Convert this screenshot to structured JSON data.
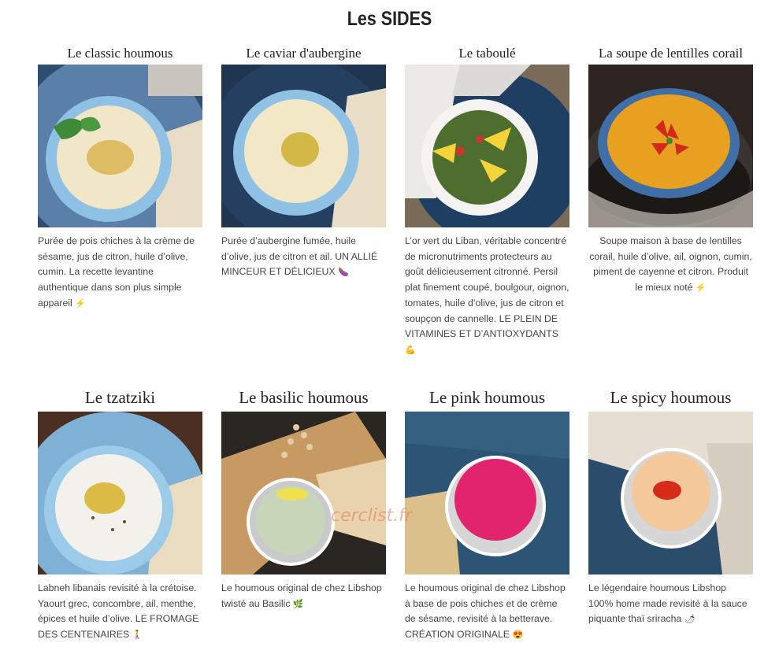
{
  "page": {
    "title": "Les SIDES"
  },
  "cards": [
    {
      "title": "Le classic houmous",
      "image": "classic-houmous-photo",
      "description": "Purée de pois chiches à la crème de sésame, jus de citron, huile d’olive, cumin. La recette levantine authentique dans son plus simple appareil",
      "emoji": "⚡"
    },
    {
      "title": "Le caviar d'aubergine",
      "image": "caviar-aubergine-photo",
      "description": "Purée d’aubergine fumée, huile d’olive, jus de citron et ail. UN ALLIÉ MINCEUR ET DÉLICIEUX",
      "emoji": "🍆"
    },
    {
      "title": "Le taboulé",
      "image": "taboule-photo",
      "description": "L’or vert du Liban, véritable concentré de micronutriments protecteurs au goût délicieusement citronné. Persil plat finement coupé, boulgour, oignon, tomates, huile d’olive, jus de citron et soupçon de cannelle. LE PLEIN DE VITAMINES ET D’ANTIOXYDANTS",
      "emoji": "💪"
    },
    {
      "title": "La soupe de lentilles corail",
      "image": "soupe-lentilles-photo",
      "description": "Soupe maison à base de lentilles corail, huile d’olive, ail, oignon, cumin, piment de cayenne et citron. Produit le mieux noté",
      "emoji": "⚡"
    },
    {
      "title": "Le tzatziki",
      "image": "tzatziki-photo",
      "description": "Labneh libanais revisité à la crétoise. Yaourt grec, concombre, ail, menthe, épices et huile d’olive. LE FROMAGE DES CENTENAIRES",
      "emoji": "🚶"
    },
    {
      "title": "Le basilic houmous",
      "image": "basilic-houmous-photo",
      "description": "Le houmous original de chez Libshop twisté au Basilic",
      "emoji": "🌿"
    },
    {
      "title": "Le pink houmous",
      "image": "pink-houmous-photo",
      "description": "Le houmous original de chez Libshop à base de pois chiches et de crème de sésame, revisité à la betterave. CRÉATION ORIGINALE",
      "emoji": "😍"
    },
    {
      "title": "Le spicy houmous",
      "image": "spicy-houmous-photo",
      "description": "Le légendaire houmous Libshop 100% home made revisité à la sauce piquante thaï sriracha",
      "emoji": "🌶"
    }
  ],
  "watermark": "cerclist.fr"
}
